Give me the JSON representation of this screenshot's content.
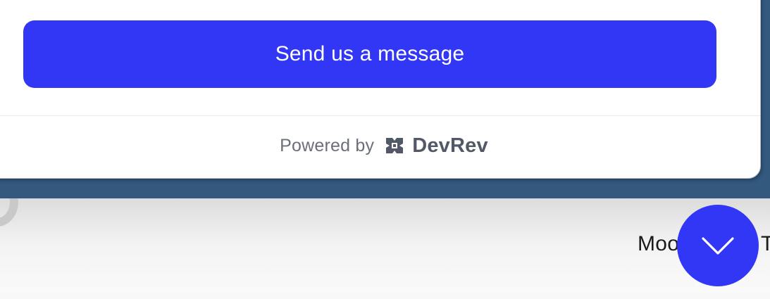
{
  "widget": {
    "send_button_label": "Send us a message",
    "footer": {
      "powered_by": "Powered by",
      "brand_name": "DevRev",
      "brand_icon": "devrev-logo-icon"
    }
  },
  "page": {
    "nav_text_partial": "Moo",
    "edge_text_partial": "T"
  },
  "launcher": {
    "icon": "chevron-down-icon"
  },
  "colors": {
    "accent": "#3137f5",
    "header_band": "#33597f",
    "footer_text": "#6b6f7a",
    "brand_text": "#525866"
  }
}
